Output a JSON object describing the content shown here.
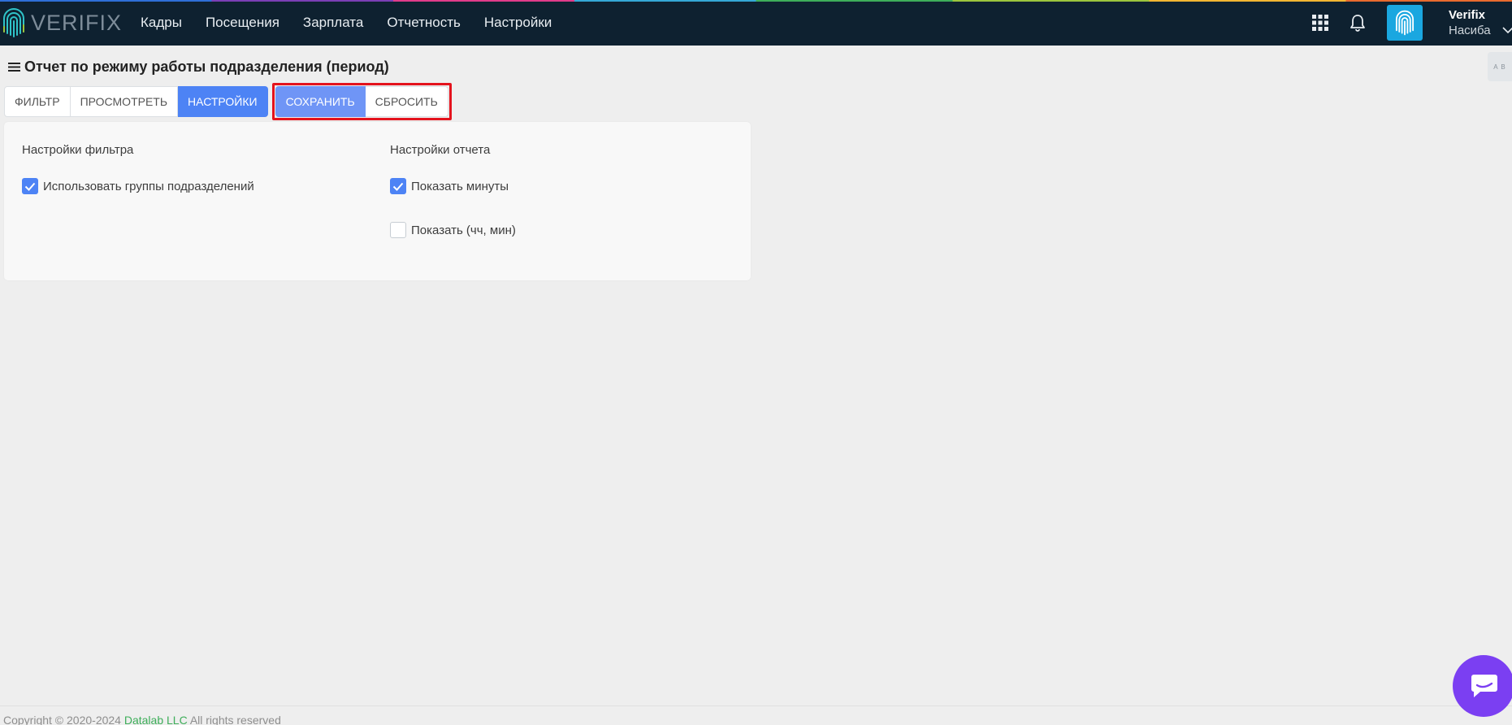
{
  "app": {
    "logo_text": "VERIFIX",
    "logo_icon": "fingerprint-icon"
  },
  "nav": {
    "items": [
      {
        "label": "Кадры"
      },
      {
        "label": "Посещения"
      },
      {
        "label": "Зарплата"
      },
      {
        "label": "Отчетность"
      },
      {
        "label": "Настройки"
      }
    ]
  },
  "header_right": {
    "apps_icon": "grid-icon",
    "bell_icon": "bell-icon",
    "avatar_icon": "fingerprint-icon",
    "user_name": "Verifix",
    "user_sub": "Насиба"
  },
  "page": {
    "title": "Отчет по режиму работы подразделения (период)",
    "side_tab_text": "A B"
  },
  "toolbar": {
    "filter_label": "Фильтр",
    "view_label": "Просмотреть",
    "settings_label": "Настройки",
    "save_label": "Сохранить",
    "reset_label": "Сбросить"
  },
  "settings": {
    "filter_title": "Настройки фильтра",
    "report_title": "Настройки отчета",
    "use_groups": {
      "label": "Использовать группы подразделений",
      "checked": true
    },
    "show_minutes": {
      "label": "Показать минуты",
      "checked": true
    },
    "show_hhmm": {
      "label": "Показать (чч, мин)",
      "checked": false
    }
  },
  "footer": {
    "copyright": "Copyright © 2020-2024",
    "company": "Datalab LLC",
    "rights": "All rights reserved"
  },
  "colors": {
    "topbar": "#0e2130",
    "accent": "#4d83f5",
    "highlight": "#e4131d",
    "chat": "#7b3ff2"
  }
}
